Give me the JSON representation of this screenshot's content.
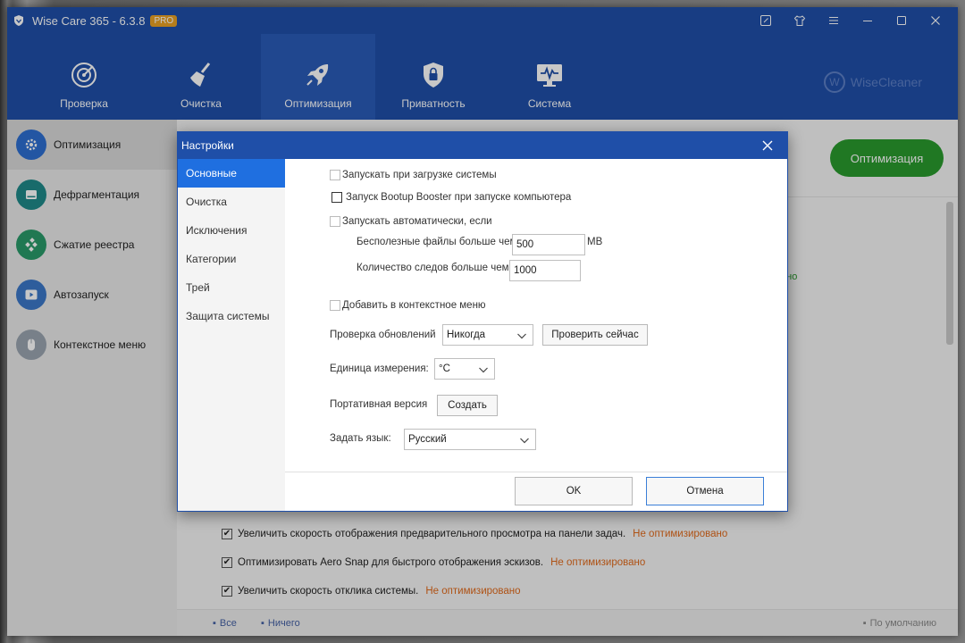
{
  "app": {
    "title": "Wise Care 365 - 6.3.8",
    "badge": "PRO",
    "brand": "WiseCleaner",
    "brand_mark": "W"
  },
  "nav": {
    "tabs": [
      {
        "label": "Проверка",
        "icon": "target-icon"
      },
      {
        "label": "Очистка",
        "icon": "broom-icon"
      },
      {
        "label": "Оптимизация",
        "icon": "rocket-icon",
        "active": true
      },
      {
        "label": "Приватность",
        "icon": "lock-shield-icon"
      },
      {
        "label": "Система",
        "icon": "monitor-icon"
      }
    ]
  },
  "sidebar": {
    "items": [
      {
        "label": "Оптимизация",
        "icon": "gear-icon",
        "active": true
      },
      {
        "label": "Дефрагментация",
        "icon": "disk-icon"
      },
      {
        "label": "Сжатие реестра",
        "icon": "registry-icon"
      },
      {
        "label": "Автозапуск",
        "icon": "play-icon"
      },
      {
        "label": "Контекстное меню",
        "icon": "mouse-icon"
      }
    ]
  },
  "main": {
    "optimize_button": "Оптимизация",
    "peek_text": "ано",
    "options": [
      {
        "label": "Увеличить скорость отображения предварительного просмотра на панели задач.",
        "status": "Не оптимизировано",
        "checked": true
      },
      {
        "label": "Оптимизировать Aero Snap для быстрого отображения эскизов.",
        "status": "Не оптимизировано",
        "checked": true
      },
      {
        "label": "Увеличить скорость отклика системы.",
        "status": "Не оптимизировано",
        "checked": true
      }
    ],
    "footer": {
      "all": "Все",
      "none": "Ничего",
      "default": "По умолчанию"
    }
  },
  "dialog": {
    "title": "Настройки",
    "side": [
      {
        "label": "Основные",
        "active": true
      },
      {
        "label": "Очистка"
      },
      {
        "label": "Исключения"
      },
      {
        "label": "Категории"
      },
      {
        "label": "Трей"
      },
      {
        "label": "Защита системы"
      }
    ],
    "startup_label": "Запускать при загрузке системы",
    "bootup_label": "Запуск Bootup Booster при запуске компьютера",
    "auto_label": "Запускать автоматически, если",
    "junk_label": "Бесполезные файлы больше чем",
    "junk_value": "500",
    "junk_unit": "MB",
    "traces_label": "Количество следов больше чем",
    "traces_value": "1000",
    "context_label": "Добавить в контекстное меню",
    "updates_label": "Проверка обновлений",
    "updates_value": "Никогда",
    "check_now": "Проверить сейчас",
    "unit_label": "Единица измерения:",
    "unit_value": "°C",
    "portable_label": "Портативная версия",
    "create": "Создать",
    "lang_label": "Задать язык:",
    "lang_value": "Русский",
    "ok": "OK",
    "cancel": "Отмена"
  },
  "colors": {
    "header_blue": "#1f4fa8",
    "accent_green": "#2a9a2e",
    "warn_orange": "#e06a1c",
    "selected_blue": "#1f6fe0"
  }
}
